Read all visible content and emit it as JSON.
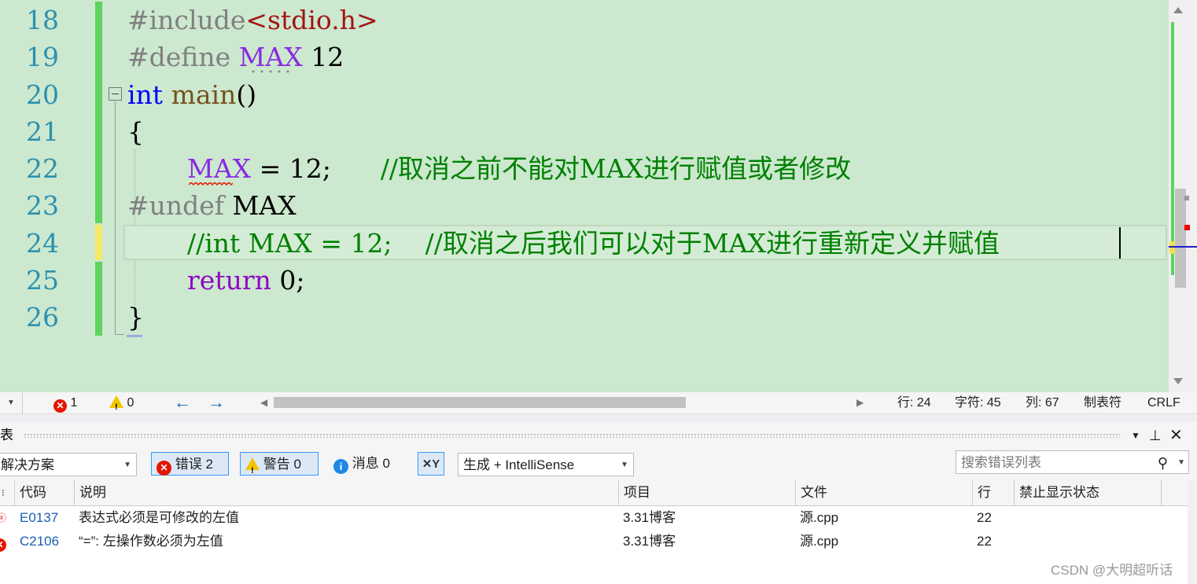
{
  "editor": {
    "line_numbers": [
      "18",
      "19",
      "20",
      "21",
      "22",
      "23",
      "24",
      "25",
      "26"
    ],
    "lines": {
      "l18_pp": "#include",
      "l18_file": "<stdio.h>",
      "l19_pp": "#define ",
      "l19_macro": "MAX",
      "l19_val": " 12",
      "l20_kw": "int",
      "l20_fn": " main",
      "l20_paren": "()",
      "l21": "{",
      "l22_macro": "MAX",
      "l22_code": " = 12;      ",
      "l22_cmt": "//取消之前不能对MAX进行赋值或者修改",
      "l23_pp": "#undef",
      "l23_name": " MAX",
      "l24_cmt": "//int MAX = 12;    //取消之后我们可以对于MAX进行重新定义并赋值",
      "l25_kw": "return",
      "l25_val": " 0;",
      "l26": "}"
    }
  },
  "status": {
    "errors": "1",
    "warnings": "0",
    "line": "行: 24",
    "char": "字符: 45",
    "col": "列: 67",
    "tabs": "制表符",
    "eol": "CRLF"
  },
  "error_list": {
    "title": "表",
    "scope": "解决方案",
    "errors_btn": "错误 2",
    "warnings_btn": "警告 0",
    "messages_btn": "消息 0",
    "build_filter": "生成 + IntelliSense",
    "search_placeholder": "搜索错误列表",
    "columns": [
      "代码",
      "说明",
      "项目",
      "文件",
      "行",
      "禁止显示状态"
    ],
    "rows": [
      {
        "code": "E0137",
        "desc": "表达式必须是可修改的左值",
        "project": "3.31博客",
        "file": "源.cpp",
        "line": "22"
      },
      {
        "code": "C2106",
        "desc": "“=”: 左操作数必须为左值",
        "project": "3.31博客",
        "file": "源.cpp",
        "line": "22"
      }
    ]
  },
  "watermark": "CSDN @大明超听话",
  "colors": {
    "editor_bg": "#cce8cf",
    "line_number": "#2b91af",
    "keyword": "#0000ff",
    "comment": "#008000",
    "macro": "#8a2be2",
    "error": "#e51400"
  }
}
